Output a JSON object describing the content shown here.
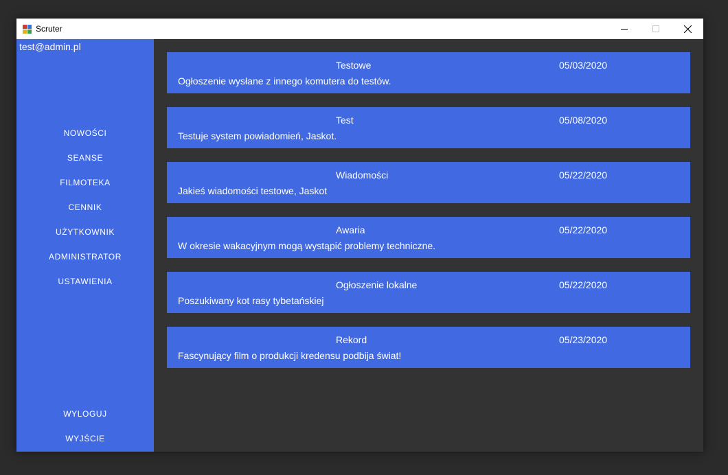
{
  "window": {
    "title": "Scruter"
  },
  "sidebar": {
    "user_email": "test@admin.pl",
    "menu": [
      {
        "label": "NOWOŚCI"
      },
      {
        "label": "SEANSE"
      },
      {
        "label": "FILMOTEKA"
      },
      {
        "label": "CENNIK"
      },
      {
        "label": "UŻYTKOWNIK"
      },
      {
        "label": "ADMINISTRATOR"
      },
      {
        "label": "USTAWIENIA"
      }
    ],
    "bottom_menu": [
      {
        "label": "WYLOGUJ"
      },
      {
        "label": "WYJŚCIE"
      }
    ]
  },
  "notices": [
    {
      "title": "Testowe",
      "date": "05/03/2020",
      "body": "Ogłoszenie wysłane z innego komutera do testów."
    },
    {
      "title": "Test",
      "date": "05/08/2020",
      "body": "Testuje system powiadomień, Jaskot."
    },
    {
      "title": "Wiadomości",
      "date": "05/22/2020",
      "body": "Jakieś wiadomości testowe, Jaskot"
    },
    {
      "title": "Awaria",
      "date": "05/22/2020",
      "body": "W okresie wakacyjnym mogą wystąpić problemy techniczne."
    },
    {
      "title": "Ogłoszenie lokalne",
      "date": "05/22/2020",
      "body": "Poszukiwany kot rasy tybetańskiej"
    },
    {
      "title": "Rekord",
      "date": "05/23/2020",
      "body": "Fascynujący film o produkcji kredensu podbija świat!"
    }
  ],
  "colors": {
    "accent": "#4169e1",
    "background": "#333333",
    "outer": "#2b2b2b"
  }
}
